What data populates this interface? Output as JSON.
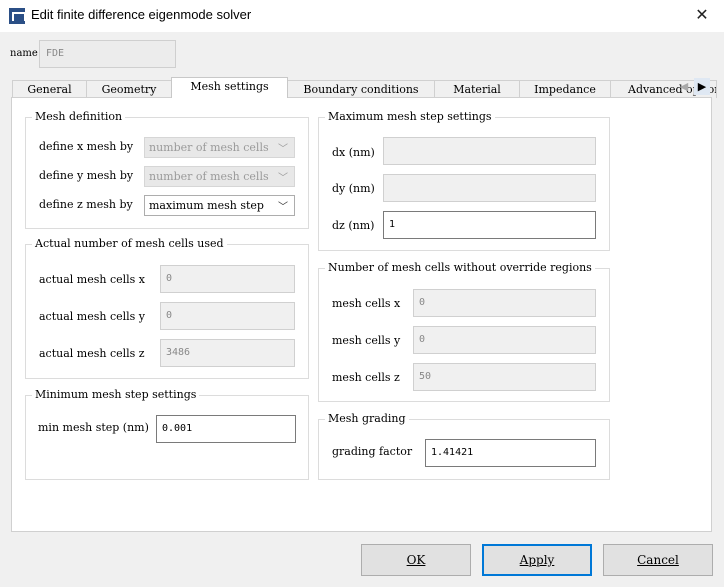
{
  "window": {
    "title": "Edit finite difference eigenmode solver",
    "close_glyph": "✕",
    "app_icon": "lumerical-app-icon"
  },
  "name": {
    "label": "name",
    "value": "FDE"
  },
  "tabs": [
    {
      "label": "General"
    },
    {
      "label": "Geometry"
    },
    {
      "label": "Mesh settings"
    },
    {
      "label": "Boundary conditions"
    },
    {
      "label": "Material"
    },
    {
      "label": "Impedance"
    },
    {
      "label": "Advanced options"
    }
  ],
  "active_tab": "Mesh settings",
  "tab_scroll": {
    "left": "◀",
    "right": "▶"
  },
  "mesh_definition": {
    "title": "Mesh definition",
    "x_label": "define x mesh by",
    "x_value": "number of mesh cells",
    "y_label": "define y mesh by",
    "y_value": "number of mesh cells",
    "z_label": "define z mesh by",
    "z_value": "maximum mesh step",
    "chevron": "﹀"
  },
  "actual_cells": {
    "title": "Actual number of mesh cells used",
    "x_label": "actual mesh cells x",
    "x_value": "0",
    "y_label": "actual mesh cells y",
    "y_value": "0",
    "z_label": "actual mesh cells z",
    "z_value": "3486"
  },
  "min_step": {
    "title": "Minimum mesh step settings",
    "label": "min mesh step (nm)",
    "value": "0.001"
  },
  "max_step": {
    "title": "Maximum mesh step settings",
    "dx_label": "dx (nm)",
    "dx_value": "",
    "dy_label": "dy (nm)",
    "dy_value": "",
    "dz_label": "dz (nm)",
    "dz_value": "1"
  },
  "no_override": {
    "title": "Number of mesh cells without override regions",
    "x_label": "mesh cells x",
    "x_value": "0",
    "y_label": "mesh cells y",
    "y_value": "0",
    "z_label": "mesh cells z",
    "z_value": "50"
  },
  "grading": {
    "title": "Mesh grading",
    "label": "grading factor",
    "value": "1.41421"
  },
  "buttons": {
    "ok": "OK",
    "apply": "Apply",
    "cancel": "Cancel"
  }
}
